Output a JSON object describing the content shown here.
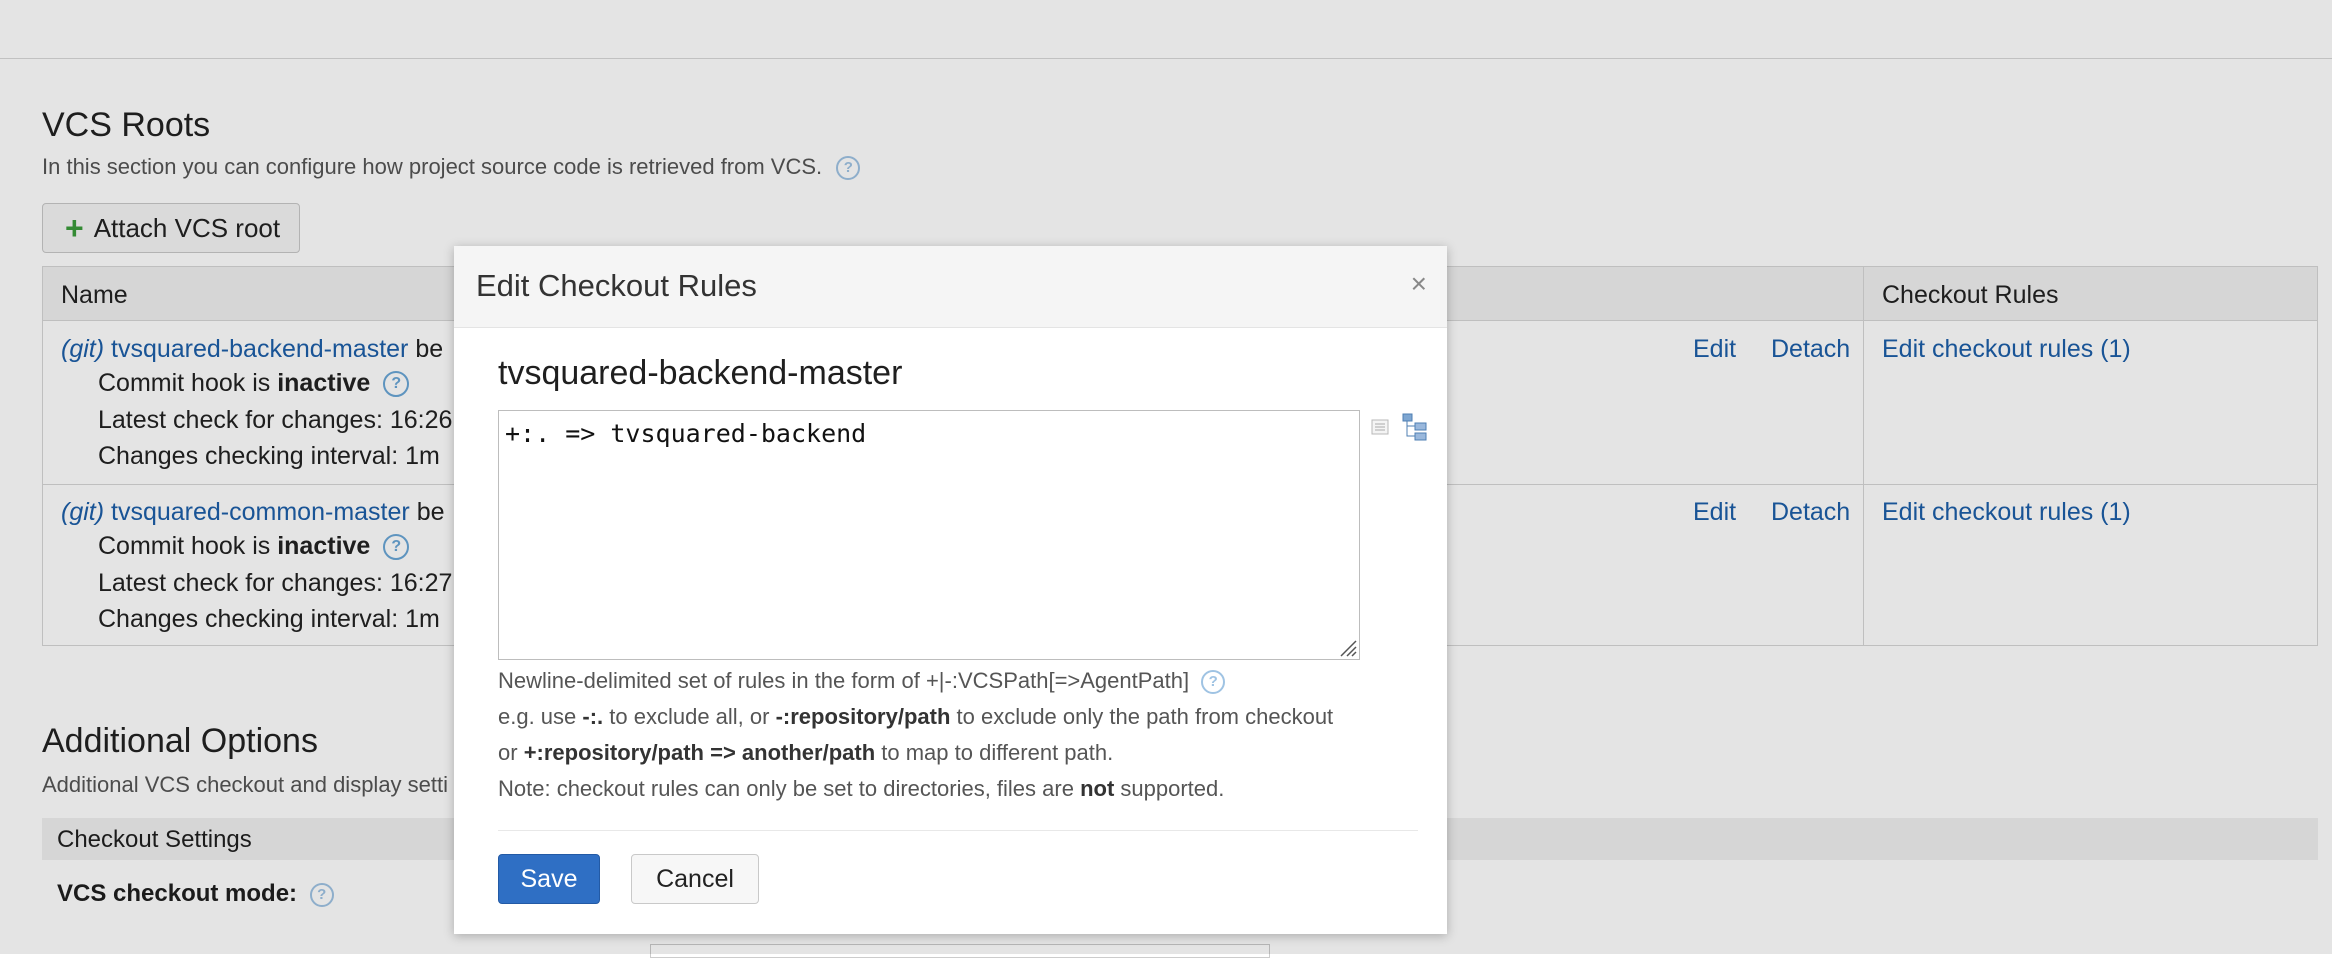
{
  "vcs_roots": {
    "title": "VCS Roots",
    "description": "In this section you can configure how project source code is retrieved from VCS.",
    "attach_button": "Attach VCS root",
    "columns": {
      "name": "Name",
      "checkout_rules": "Checkout Rules"
    },
    "rows": [
      {
        "type": "(git)",
        "name": "tvsquared-backend-master",
        "name_suffix": "be",
        "commit_hook_prefix": "Commit hook is ",
        "commit_hook_state": "inactive",
        "latest_check": "Latest check for changes: 16:26",
        "interval": "Changes checking interval: 1m",
        "edit": "Edit",
        "detach": "Detach",
        "checkout_rules": "Edit checkout rules (1)"
      },
      {
        "type": "(git)",
        "name": "tvsquared-common-master",
        "name_suffix": "be",
        "commit_hook_prefix": "Commit hook is ",
        "commit_hook_state": "inactive",
        "latest_check": "Latest check for changes: 16:27",
        "interval": "Changes checking interval: 1m",
        "edit": "Edit",
        "detach": "Detach",
        "checkout_rules": "Edit checkout rules (1)"
      }
    ]
  },
  "additional_options": {
    "title": "Additional Options",
    "description": "Additional VCS checkout and display setti",
    "checkout_settings": "Checkout Settings",
    "vcs_checkout_mode": "VCS checkout mode:"
  },
  "dialog": {
    "title": "Edit Checkout Rules",
    "close": "×",
    "root_name": "tvsquared-backend-master",
    "rules_value": "+:. => tvsquared-backend",
    "hint_line1": "Newline-delimited set of rules in the form of +|-:VCSPath[=>AgentPath]",
    "hint_line2": {
      "a": "e.g. use ",
      "b": "-:.",
      "c": " to exclude all, or ",
      "d": "-:repository/path",
      "e": " to exclude only the path from checkout"
    },
    "hint_line3": {
      "a": "or ",
      "b": "+:repository/path => another/path",
      "c": " to map to different path."
    },
    "hint_line4": {
      "a": "Note: checkout rules can only be set to directories, files are ",
      "b": "not",
      "c": " supported."
    },
    "save": "Save",
    "cancel": "Cancel"
  }
}
